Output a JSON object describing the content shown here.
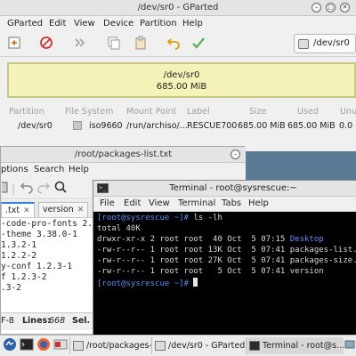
{
  "gparted": {
    "title": "/dev/sr0 - GParted",
    "menu": [
      "GParted",
      "Edit",
      "View",
      "Device",
      "Partition",
      "Help"
    ],
    "device_selector": "/dev/sr0",
    "partition_bar": {
      "label": "/dev/sr0",
      "size": "685.00 MiB",
      "color": "#f4f4b8"
    },
    "columns": [
      "Partition",
      "File System",
      "Mount Point",
      "Label",
      "Size",
      "Used",
      "Unused"
    ],
    "row": [
      "/dev/sr0",
      "iso9660",
      "/run/archiso/...",
      "RESCUE700",
      "685.00 MiB",
      "685.00 MiB",
      "0.0"
    ]
  },
  "editor": {
    "title": "/root/packages-list.txt",
    "menu": [
      "ptions",
      "Search",
      "Help"
    ],
    "tabs": [
      {
        "label": ".txt",
        "close": "✕"
      },
      {
        "label": "version",
        "close": "✕"
      }
    ],
    "lines": [
      "-code-pro-fonts 2.03",
      "-theme 3.38.0-1",
      "1.3.2-1",
      "1.2.2-2",
      "y-conf 1.2.3-1",
      "f 1.2.3-2",
      ".3-2"
    ],
    "status": {
      "encoding": "F-8",
      "lines_label": "Lines:",
      "lines_value": "668",
      "sel_label": "Sel. C"
    }
  },
  "terminal": {
    "title": "Terminal - root@sysrescue:~",
    "menu": [
      "File",
      "Edit",
      "View",
      "Terminal",
      "Tabs",
      "Help"
    ],
    "prompt": "[root@sysrescue ~]#",
    "command": " ls -lh",
    "total": "total 40K",
    "listing": [
      {
        "perms": "drwxr-xr-x 2 root root  40 Oct  5 07:15 ",
        "name": "Desktop",
        "is_dir": true
      },
      {
        "perms": "-rw-r--r-- 1 root root 13K Oct  5 07:41 ",
        "name": "packages-list.t",
        "is_dir": false
      },
      {
        "perms": "-rw-r--r-- 1 root root 27K Oct  5 07:41 ",
        "name": "packages-size.t",
        "is_dir": false
      },
      {
        "perms": "-rw-r--r-- 1 root root   5 Oct  5 07:41 ",
        "name": "version",
        "is_dir": false
      }
    ],
    "prompt2": "[root@sysrescue ~]#"
  },
  "taskbar": {
    "tasks": [
      {
        "label": "/root/packages-lis...",
        "active": false
      },
      {
        "label": "/dev/sr0 - GParted",
        "active": false
      },
      {
        "label": "Terminal - root@s...",
        "active": true
      }
    ]
  }
}
